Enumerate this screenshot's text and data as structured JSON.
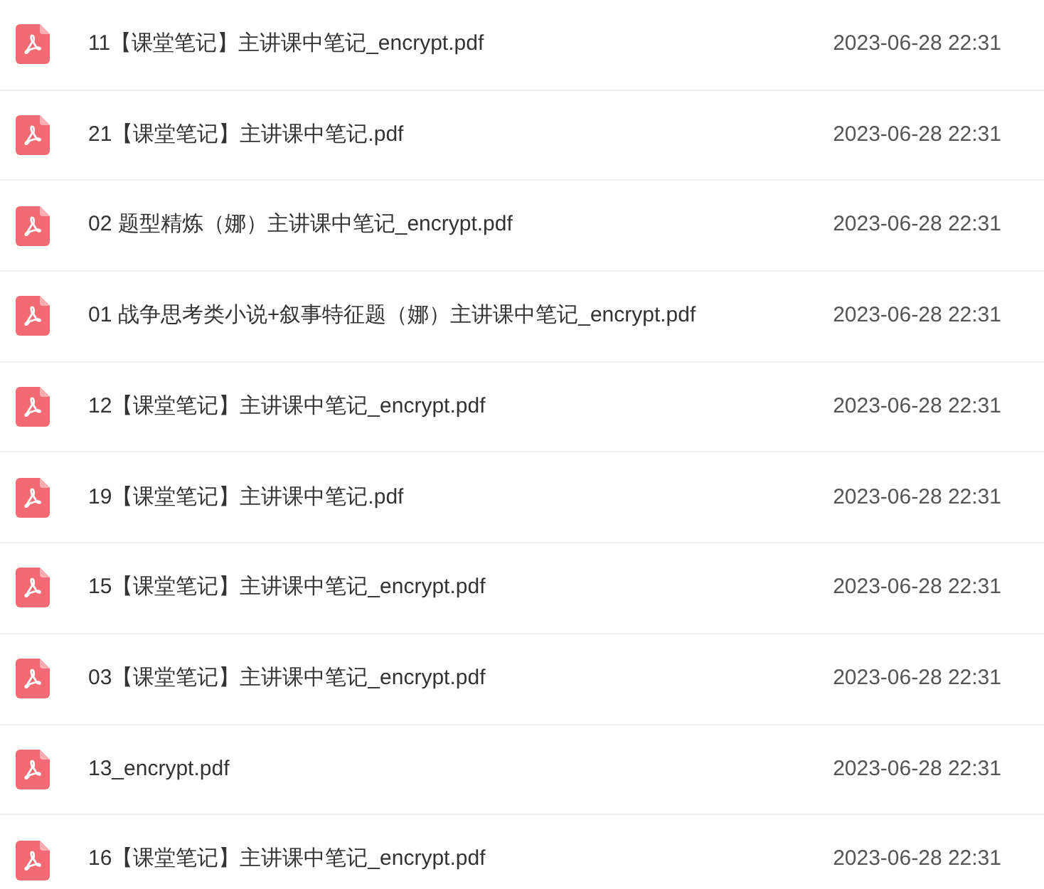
{
  "files": [
    {
      "name": "11【课堂笔记】主讲课中笔记_encrypt.pdf",
      "modified": "2023-06-28 22:31"
    },
    {
      "name": "21【课堂笔记】主讲课中笔记.pdf",
      "modified": "2023-06-28 22:31"
    },
    {
      "name": "02 题型精炼（娜）主讲课中笔记_encrypt.pdf",
      "modified": "2023-06-28 22:31"
    },
    {
      "name": "01 战争思考类小说+叙事特征题（娜）主讲课中笔记_encrypt.pdf",
      "modified": "2023-06-28 22:31"
    },
    {
      "name": "12【课堂笔记】主讲课中笔记_encrypt.pdf",
      "modified": "2023-06-28 22:31"
    },
    {
      "name": "19【课堂笔记】主讲课中笔记.pdf",
      "modified": "2023-06-28 22:31"
    },
    {
      "name": "15【课堂笔记】主讲课中笔记_encrypt.pdf",
      "modified": "2023-06-28 22:31"
    },
    {
      "name": "03【课堂笔记】主讲课中笔记_encrypt.pdf",
      "modified": "2023-06-28 22:31"
    },
    {
      "name": "13_encrypt.pdf",
      "modified": "2023-06-28 22:31"
    },
    {
      "name": "16【课堂笔记】主讲课中笔记_encrypt.pdf",
      "modified": "2023-06-28 22:31"
    }
  ]
}
